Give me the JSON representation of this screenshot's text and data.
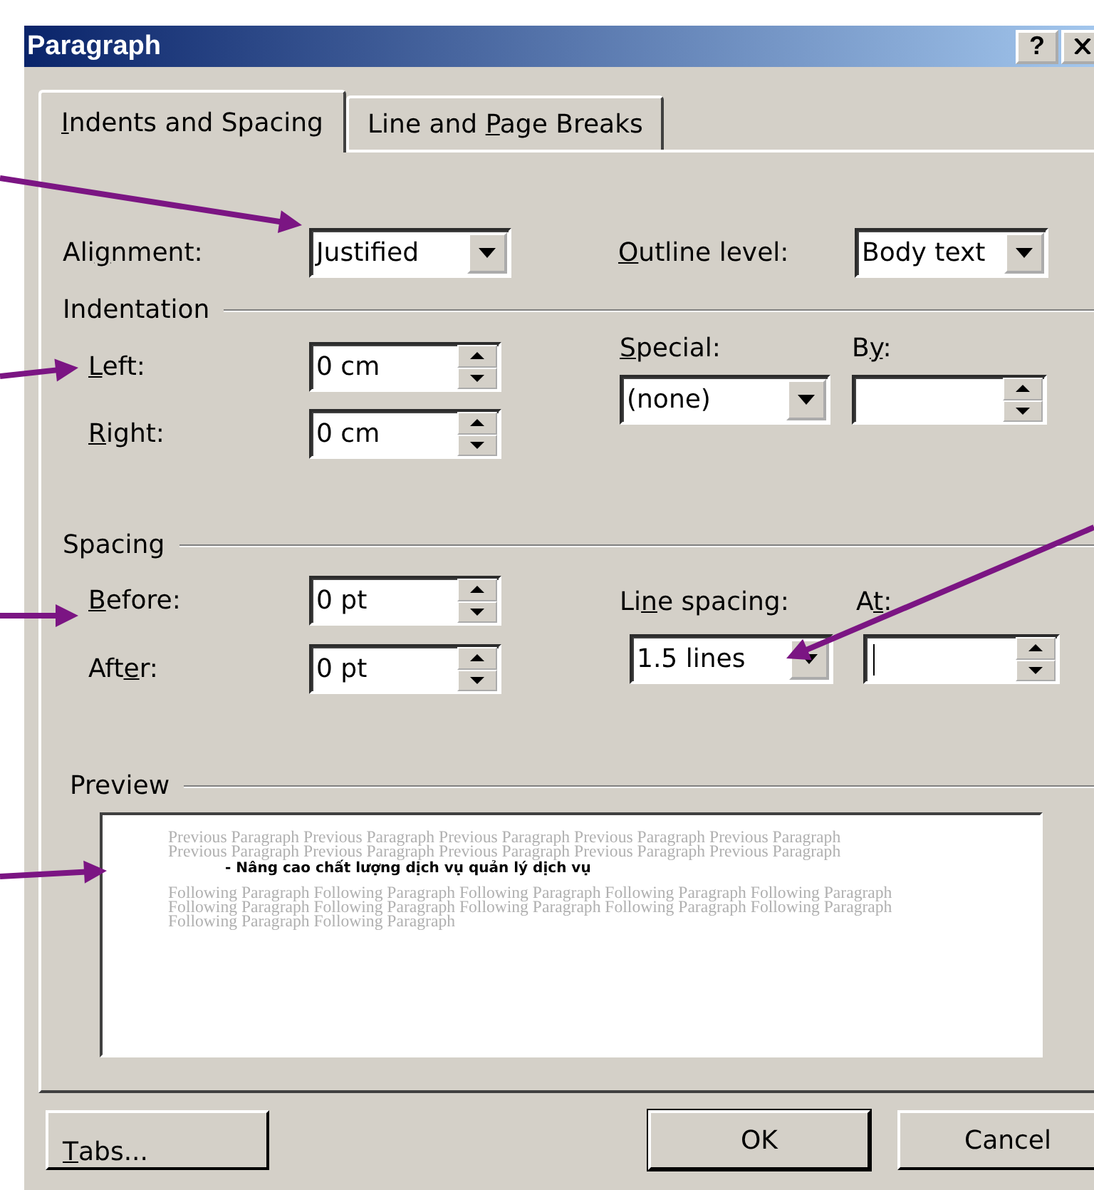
{
  "window": {
    "title": "Paragraph",
    "help_button": "?"
  },
  "tabs": [
    {
      "label": {
        "key": "I",
        "post": "ndents and Spacing"
      },
      "selected": true
    },
    {
      "label": {
        "pre": "Line and ",
        "key": "P",
        "post": "age Breaks"
      },
      "selected": false
    }
  ],
  "general": {
    "alignment": {
      "label": {
        "pre": "Ali",
        "key": "g",
        "post": "nment:"
      },
      "value": "Justified"
    },
    "outline_level": {
      "label": {
        "key": "O",
        "post": "utline level:"
      },
      "value": "Body text"
    }
  },
  "indentation": {
    "title": "Indentation",
    "left": {
      "label": {
        "key": "L",
        "post": "eft:"
      },
      "value": "0 cm"
    },
    "right": {
      "label": {
        "key": "R",
        "post": "ight:"
      },
      "value": "0 cm"
    },
    "special": {
      "label": {
        "key": "S",
        "post": "pecial:"
      },
      "value": "(none)"
    },
    "by": {
      "label": {
        "pre": "B",
        "key": "y",
        "post": ":"
      }
    }
  },
  "spacing": {
    "title": "Spacing",
    "before": {
      "label": {
        "key": "B",
        "post": "efore:"
      },
      "value": "0 pt"
    },
    "after": {
      "label": {
        "pre": "Aft",
        "key": "e",
        "post": "r:"
      },
      "value": "0 pt"
    },
    "line_spacing": {
      "label": {
        "pre": "Li",
        "key": "n",
        "post": "e spacing:"
      },
      "value": "1.5 lines"
    },
    "at": {
      "label": {
        "pre": "A",
        "key": "t",
        "post": ":"
      },
      "focused": true
    }
  },
  "preview": {
    "title": "Preview",
    "previous_lines": [
      "Previous Paragraph Previous Paragraph Previous Paragraph Previous Paragraph Previous Paragraph",
      "Previous Paragraph Previous Paragraph Previous Paragraph Previous Paragraph Previous Paragraph"
    ],
    "paragraph": "- Nâng cao chất lượng dịch vụ quản lý dịch vụ",
    "following_lines": [
      "Following Paragraph Following Paragraph Following Paragraph Following Paragraph Following Paragraph",
      "Following Paragraph Following Paragraph Following Paragraph Following Paragraph Following Paragraph",
      "Following Paragraph Following Paragraph"
    ]
  },
  "buttons": [
    {
      "label": {
        "key": "T",
        "post": "abs..."
      },
      "kind": "tabs"
    },
    {
      "label": "OK",
      "kind": "default"
    },
    {
      "label": "Cancel",
      "kind": "normal"
    }
  ]
}
